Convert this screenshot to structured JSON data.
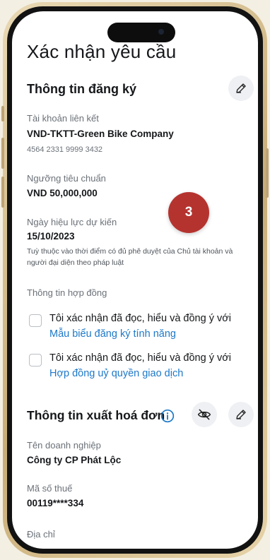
{
  "page": {
    "title": "Xác nhận yêu cầu"
  },
  "registration": {
    "title": "Thông tin đăng ký",
    "linked_account_label": "Tài khoản liên kết",
    "linked_account_name": "VND-TKTT-Green Bike Company",
    "linked_account_number": "4564 2331 9999 3432",
    "threshold_label": "Ngưỡng tiêu chuẩn",
    "threshold_value": "VND 50,000,000",
    "effective_date_label": "Ngày hiệu lực dự kiến",
    "effective_date_value": "15/10/2023",
    "effective_date_note": "Tuỳ thuộc vào thời điểm có đủ phê duyệt của Chủ tài khoản và người đại diện theo pháp luật"
  },
  "contract": {
    "title": "Thông tin hợp đồng",
    "items": [
      {
        "text": "Tôi xác nhận đã đọc, hiểu và đồng ý với",
        "link": "Mẫu biểu đăng ký tính năng",
        "checked": false
      },
      {
        "text": "Tôi xác nhận đã đọc, hiểu và đồng ý với",
        "link": "Hợp đồng uỷ quyền giao dịch",
        "checked": false
      }
    ]
  },
  "invoice": {
    "title": "Thông tin xuất hoá đơn",
    "company_label": "Tên doanh nghiệp",
    "company_value": "Công ty CP Phát Lộc",
    "tax_label": "Mã số thuế",
    "tax_value": "00119****334",
    "address_label": "Địa chỉ"
  },
  "step_badge": "3",
  "icons": {
    "edit": "pencil-icon",
    "info": "info-icon",
    "hide": "eye-off-icon"
  },
  "colors": {
    "link": "#1d78c8",
    "badge": "#b5332f"
  }
}
